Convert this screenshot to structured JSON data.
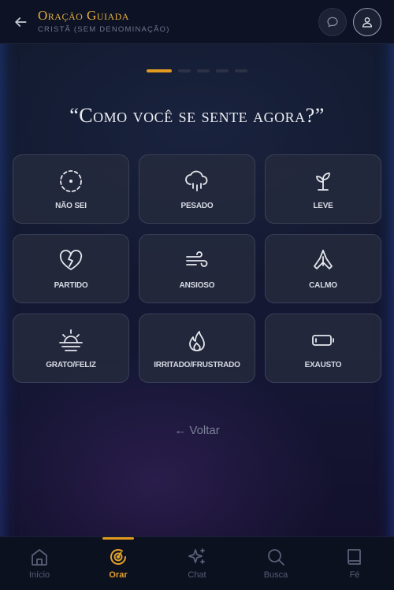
{
  "header": {
    "title": "Oração Guiada",
    "subtitle": "CRISTÃ (SEM DENOMINAÇÃO)",
    "back_icon": "arrow-left-icon",
    "chat_icon": "chat-bubble-icon",
    "profile_icon": "user-icon"
  },
  "progress": {
    "total_steps": 5,
    "current_step": 1
  },
  "question": "“Como você se sente agora?”",
  "feelings": [
    {
      "label": "Não sei",
      "icon": "dashed-circle-icon"
    },
    {
      "label": "Pesado",
      "icon": "rain-cloud-icon"
    },
    {
      "label": "Leve",
      "icon": "sprout-icon"
    },
    {
      "label": "Partido",
      "icon": "broken-heart-icon"
    },
    {
      "label": "Ansioso",
      "icon": "wind-icon"
    },
    {
      "label": "Calmo",
      "icon": "praying-hands-icon"
    },
    {
      "label": "Grato/Feliz",
      "icon": "sunrise-icon"
    },
    {
      "label": "Irritado/Frustrado",
      "icon": "flame-icon"
    },
    {
      "label": "Exausto",
      "icon": "low-battery-icon"
    }
  ],
  "back_link": "← Voltar",
  "nav": {
    "items": [
      {
        "label": "Início",
        "icon": "home-icon"
      },
      {
        "label": "Orar",
        "icon": "compass-icon",
        "active": true
      },
      {
        "label": "Chat",
        "icon": "sparkles-icon"
      },
      {
        "label": "Busca",
        "icon": "search-icon"
      },
      {
        "label": "Fé",
        "icon": "book-icon"
      }
    ]
  },
  "colors": {
    "accent": "#e39b1f",
    "title_gold": "#e3ad3c",
    "card_bg": "#262c3e",
    "background": "#131a30"
  }
}
